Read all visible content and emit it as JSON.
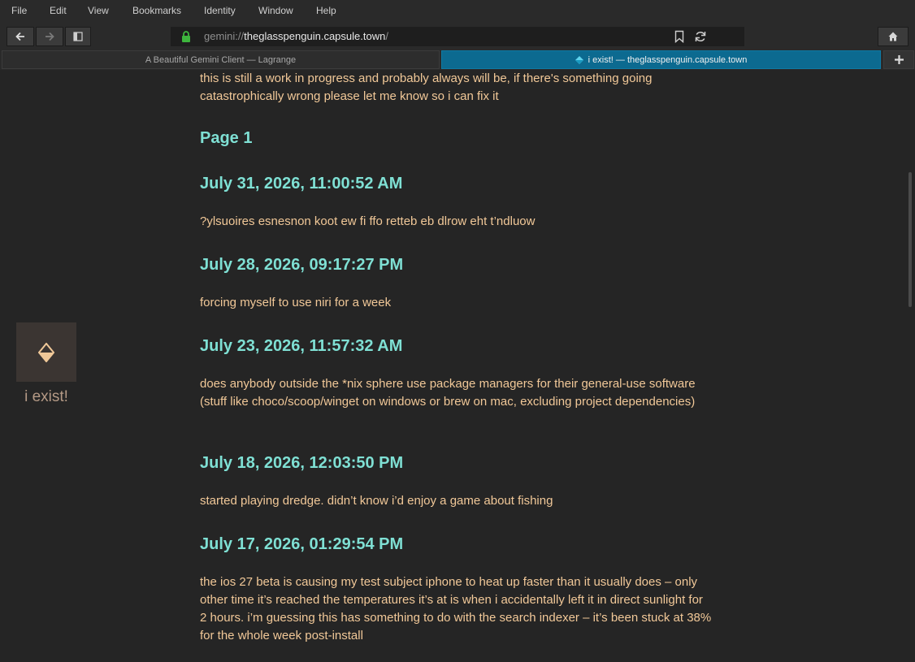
{
  "menu": {
    "items": [
      "File",
      "Edit",
      "View",
      "Bookmarks",
      "Identity",
      "Window",
      "Help"
    ]
  },
  "toolbar": {
    "url_scheme": "gemini://",
    "url_host": "theglasspenguin.capsule.town",
    "url_path": "/"
  },
  "tabs": [
    {
      "label": "A Beautiful Gemini Client — Lagrange"
    },
    {
      "label": "i exist! — theglasspenguin.capsule.town"
    }
  ],
  "sidebar": {
    "title": "i exist!"
  },
  "content": {
    "intro": "this is still a work in progress and probably always will be, if there's something going catastrophically wrong please let me know so i can fix it",
    "page_heading": "Page 1",
    "posts": [
      {
        "date": "July 31, 2026, 11:00:52 AM",
        "text": "?ylsuoires esnesnon koot ew fi ffo retteb eb dlrow eht t’ndluow"
      },
      {
        "date": "July 28, 2026, 09:17:27 PM",
        "text": "forcing myself to use niri for a week"
      },
      {
        "date": "July 23, 2026, 11:57:32 AM",
        "text": "does anybody outside the *nix sphere use package managers for their general-use software (stuff like choco/scoop/winget on windows or brew on mac, excluding project dependencies)"
      },
      {
        "date": "July 18, 2026, 12:03:50 PM",
        "text": "started playing dredge. didn’t know i’d enjoy a game about fishing"
      },
      {
        "date": "July 17, 2026, 01:29:54 PM",
        "text": "the ios 27 beta is causing my test subject iphone to heat up faster than it usually does – only other time it’s reached the temperatures it’s at is when i accidentally left it in direct sunlight for 2 hours. i’m guessing this has something to do with the search indexer – it’s been stuck at 38% for the whole week post-install"
      }
    ]
  },
  "colors": {
    "heading": "#7fe0d4",
    "body_text": "#f1c898",
    "active_tab": "#0c6a90",
    "lock": "#3db53d"
  }
}
